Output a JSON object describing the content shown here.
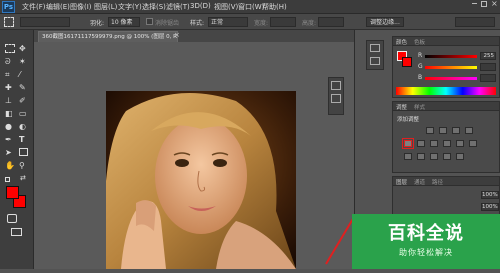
{
  "app": {
    "logo_text": "Ps"
  },
  "menu": [
    "文件(F)",
    "编辑(E)",
    "图像(I)",
    "图层(L)",
    "文字(Y)",
    "选择(S)",
    "滤镜(T)",
    "3D(D)",
    "视图(V)",
    "窗口(W)",
    "帮助(H)"
  ],
  "options_bar": {
    "feather_label": "羽化:",
    "feather_value": "10 像素",
    "antialias_label": "消除锯齿",
    "style_label": "样式:",
    "style_value": "正常",
    "width_label": "宽度:",
    "height_label": "高度:",
    "refine_edge": "调整边缘..."
  },
  "document": {
    "tab_title": "360截图16171117599979.png @ 100% (图层 0, RGB/8)"
  },
  "color_panel": {
    "tabs": [
      "颜色",
      "色板"
    ],
    "r_label": "R",
    "g_label": "G",
    "b_label": "B",
    "r_value": "255",
    "g_value": "",
    "b_value": ""
  },
  "adjustments_panel": {
    "tabs": [
      "调整",
      "样式"
    ],
    "title": "添加调整"
  },
  "layers_panel": {
    "tabs": [
      "图层",
      "通道",
      "路径"
    ],
    "value1": "100%",
    "value2": "100%"
  },
  "watermark": {
    "title": "百科全说",
    "subtitle": "助你轻松解决"
  },
  "colors": {
    "foreground": "#ff0000",
    "background": "#ff0000",
    "accent_red": "#e02020",
    "watermark_green": "#2aa24b"
  }
}
